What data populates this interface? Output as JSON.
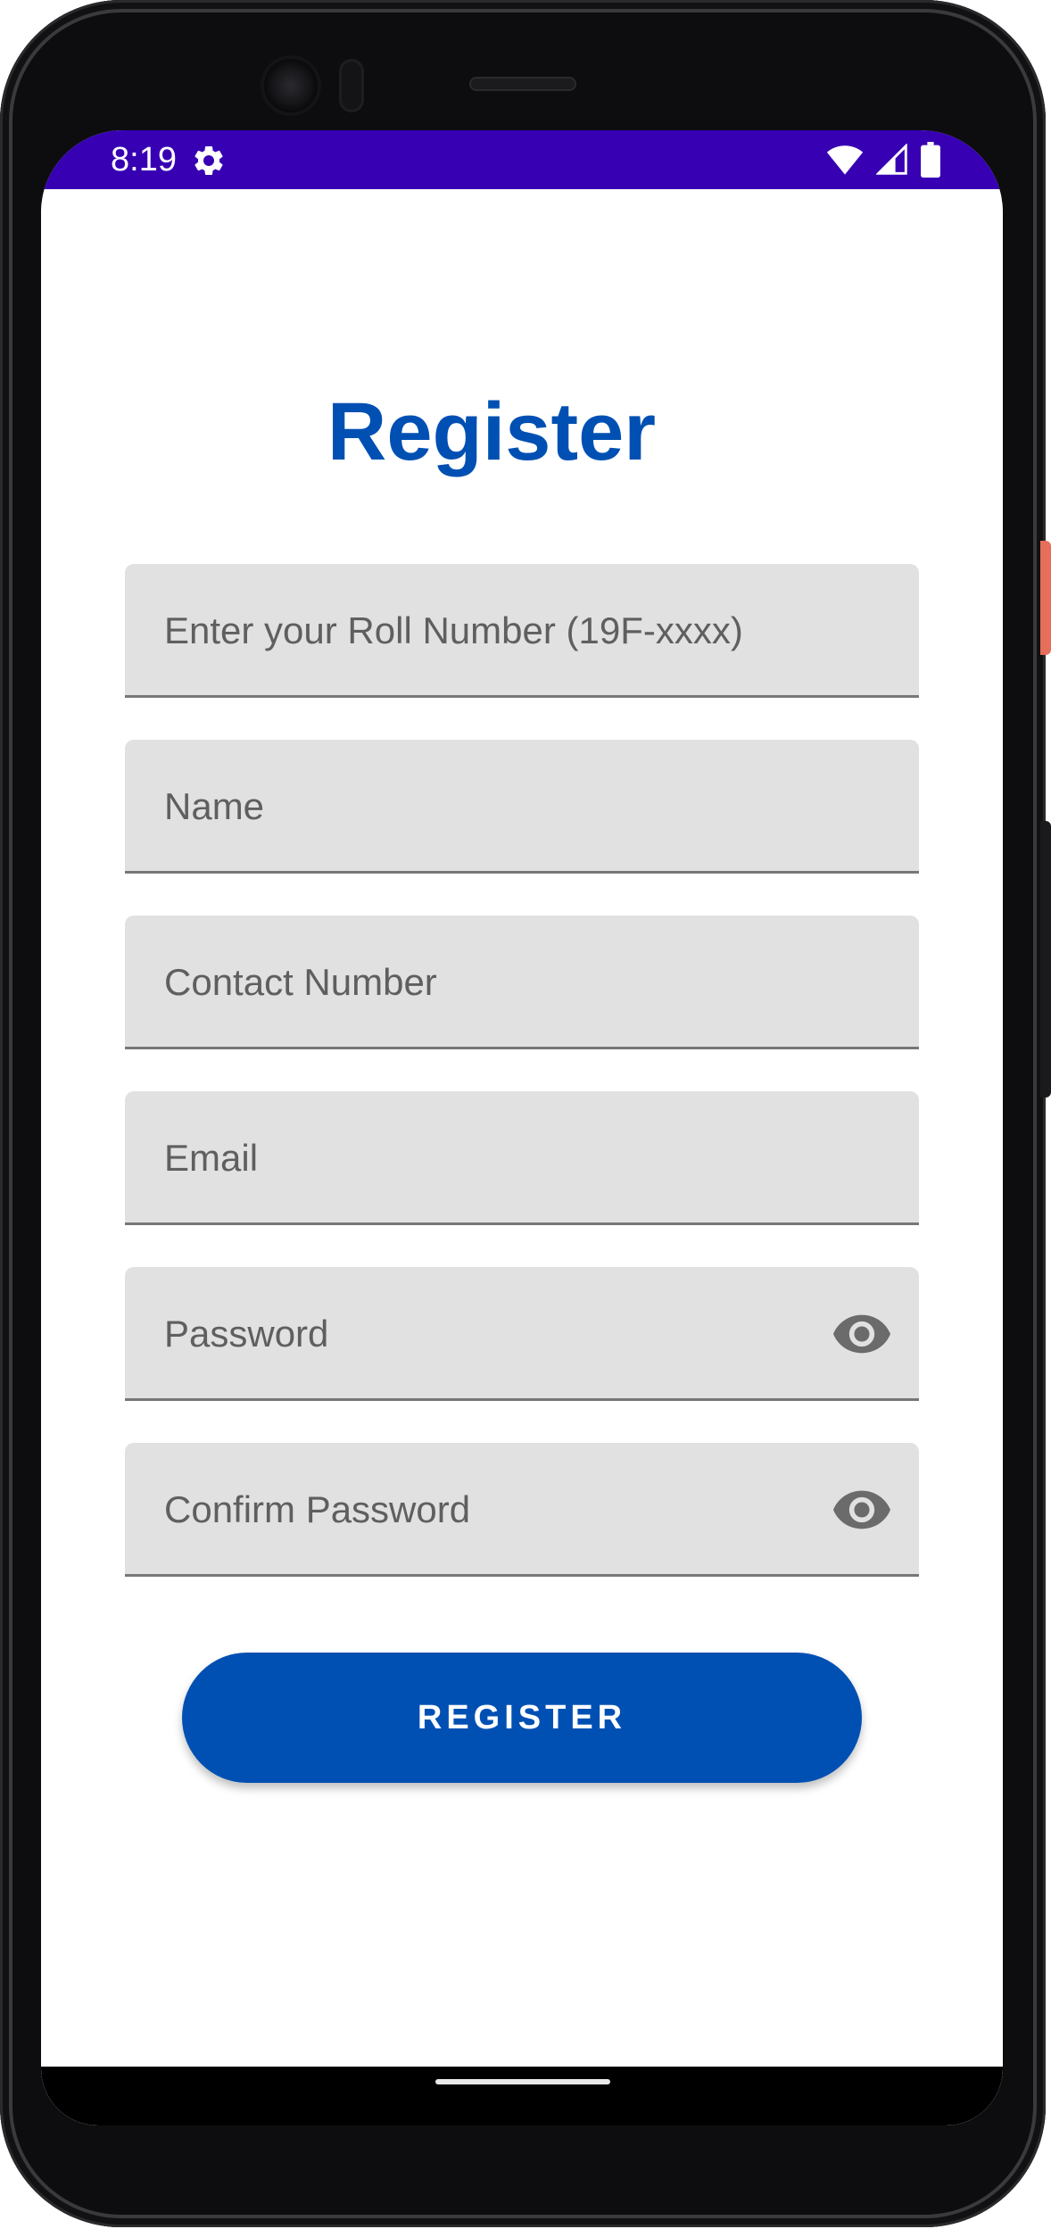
{
  "status_bar": {
    "time": "8:19",
    "settings_icon": "gear-icon",
    "wifi_icon": "wifi-icon",
    "signal_icon": "cell-signal-icon",
    "battery_icon": "battery-icon",
    "color": "#3700b3"
  },
  "screen": {
    "title": "Register",
    "fields": [
      {
        "placeholder": "Enter your Roll Number (19F-xxxx)",
        "value": ""
      },
      {
        "placeholder": "Name",
        "value": ""
      },
      {
        "placeholder": "Contact Number",
        "value": ""
      },
      {
        "placeholder": "Email",
        "value": ""
      },
      {
        "placeholder": "Password",
        "value": "",
        "toggle_icon": "eye-icon"
      },
      {
        "placeholder": "Confirm Password",
        "value": "",
        "toggle_icon": "eye-icon"
      }
    ],
    "register_button_label": "REGISTER"
  },
  "colors": {
    "accent": "#0050b3",
    "field_background": "#e1e1e1",
    "placeholder_text": "#5f5f5f"
  }
}
